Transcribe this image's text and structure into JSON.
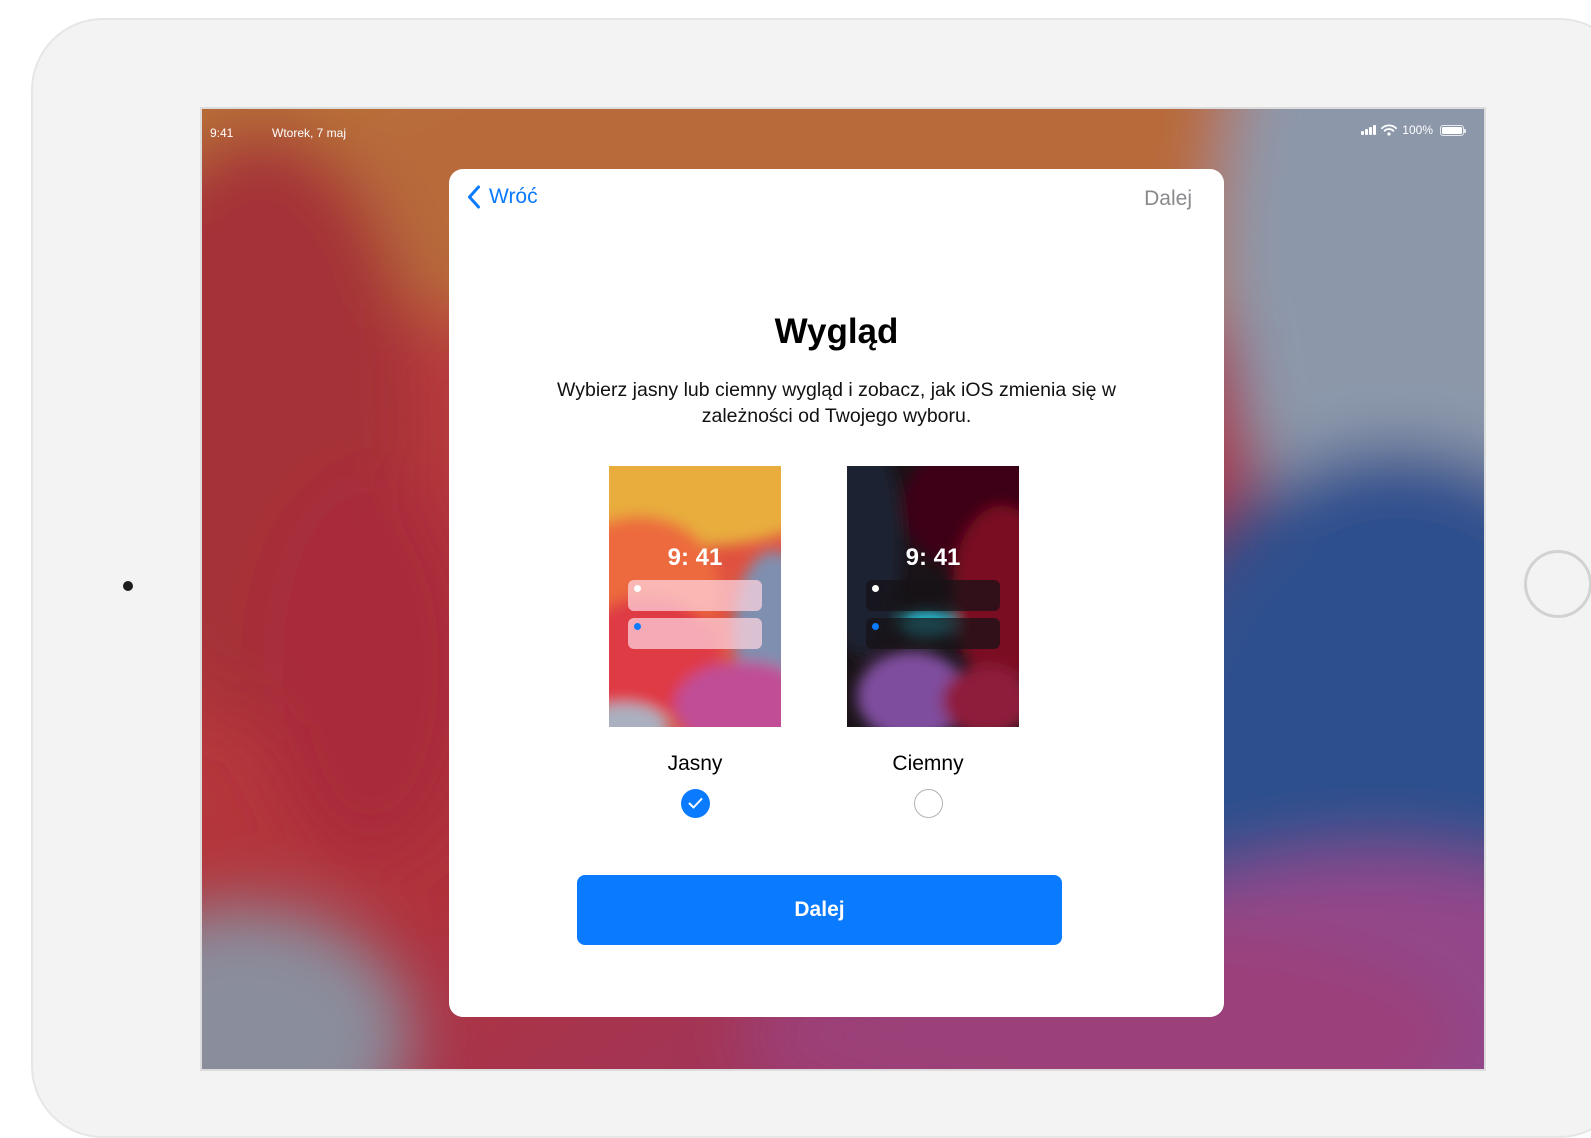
{
  "status_bar": {
    "time": "9:41",
    "date": "Wtorek, 7 maj",
    "battery": "100%"
  },
  "nav": {
    "back_label": "Wróć",
    "next_label": "Dalej"
  },
  "title": "Wygląd",
  "subtitle": "Wybierz jasny lub ciemny wygląd i zobacz, jak iOS zmienia się w zależności od Twojego wyboru.",
  "options": [
    {
      "label": "Jasny",
      "preview_time": "9: 41",
      "selected": true
    },
    {
      "label": "Ciemny",
      "preview_time": "9: 41",
      "selected": false
    }
  ],
  "continue_button": "Dalej",
  "colors": {
    "accent": "#0a7aff",
    "nav_disabled": "#8a8a8e",
    "frame": "#f3f3f3"
  }
}
